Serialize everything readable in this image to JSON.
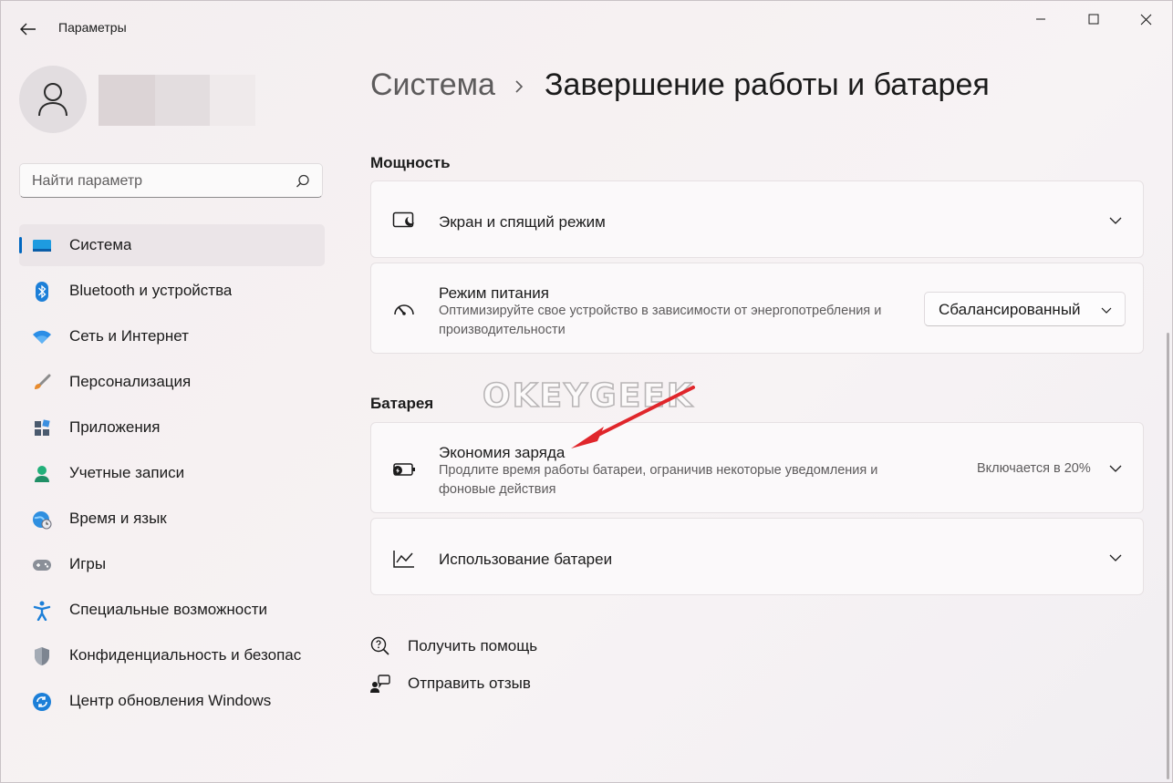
{
  "window": {
    "app_title": "Параметры",
    "controls": [
      "minimize",
      "maximize",
      "close"
    ]
  },
  "profile": {
    "avatar_icon": "person-icon"
  },
  "search": {
    "placeholder": "Найти параметр",
    "value": ""
  },
  "sidebar": {
    "items": [
      {
        "label": "Система",
        "icon": "system-icon",
        "active": true
      },
      {
        "label": "Bluetooth и устройства",
        "icon": "bluetooth-icon"
      },
      {
        "label": "Сеть и Интернет",
        "icon": "wifi-icon"
      },
      {
        "label": "Персонализация",
        "icon": "brush-icon"
      },
      {
        "label": "Приложения",
        "icon": "apps-icon"
      },
      {
        "label": "Учетные записи",
        "icon": "person-icon"
      },
      {
        "label": "Время и язык",
        "icon": "globe-clock-icon"
      },
      {
        "label": "Игры",
        "icon": "gamepad-icon"
      },
      {
        "label": "Специальные возможности",
        "icon": "accessibility-icon"
      },
      {
        "label": "Конфиденциальность и безопас",
        "icon": "shield-icon"
      },
      {
        "label": "Центр обновления Windows",
        "icon": "update-icon"
      }
    ]
  },
  "header": {
    "breadcrumb_parent": "Система",
    "breadcrumb_current": "Завершение работы и батарея"
  },
  "sections": {
    "power": {
      "title": "Мощность",
      "screen_sleep": {
        "title": "Экран и спящий режим",
        "icon": "screen-sleep-icon"
      },
      "power_mode": {
        "title": "Режим питания",
        "description": "Оптимизируйте свое устройство в зависимости от энергопотребления и производительности",
        "selected": "Сбалансированный",
        "icon": "gauge-icon"
      }
    },
    "battery": {
      "title": "Батарея",
      "saver": {
        "title": "Экономия заряда",
        "description": "Продлите время работы батареи, ограничив некоторые уведомления и фоновые действия",
        "status": "Включается в 20%",
        "icon": "battery-saver-icon"
      },
      "usage": {
        "title": "Использование батареи",
        "icon": "chart-line-icon"
      }
    }
  },
  "links": {
    "help": "Получить помощь",
    "feedback": "Отправить отзыв"
  },
  "watermark": "OKEYGEEK",
  "colors": {
    "accent": "#0067c0",
    "annotation_arrow": "#e0262b",
    "card_bg": "#fbf9fa"
  }
}
